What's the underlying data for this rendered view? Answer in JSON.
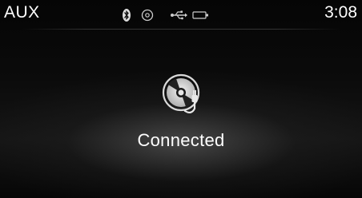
{
  "status_bar": {
    "source": "AUX",
    "time": "3:08",
    "icons": [
      "bluetooth-icon",
      "disc-icon",
      "usb-icon",
      "battery-icon"
    ]
  },
  "main": {
    "icon": "aux-disc-cable-icon",
    "status": "Connected"
  },
  "colors": {
    "text": "#ffffff",
    "background": "#000000",
    "glow": "#6e6e6e"
  }
}
